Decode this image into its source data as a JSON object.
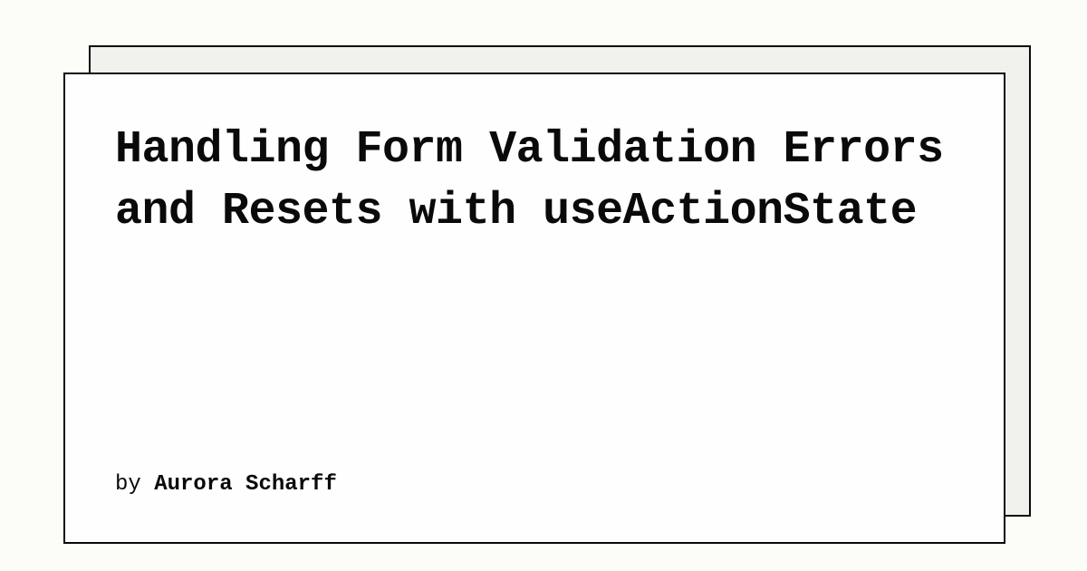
{
  "card": {
    "title": "Handling Form Validation Errors and Resets with useActionState",
    "byline_prefix": "by ",
    "author": "Aurora Scharff"
  }
}
